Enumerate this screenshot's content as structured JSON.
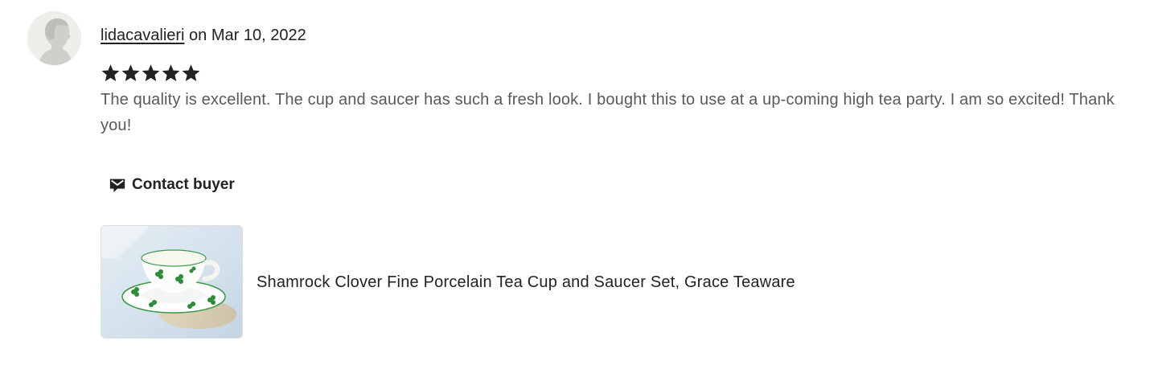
{
  "review": {
    "username": "lidacavalieri",
    "date_prefix": " on ",
    "date": "Mar 10, 2022",
    "rating": 5,
    "rating_max": 5,
    "text": "The quality is excellent. The cup and saucer has such a fresh look. I bought this to use at a up-coming high tea party. I am so excited! Thank you!",
    "contact_label": "Contact buyer",
    "listing_title": "Shamrock Clover Fine Porcelain Tea Cup and Saucer Set, Grace Teaware"
  },
  "icons": {
    "avatar": "default-user-avatar",
    "star": "star-icon",
    "contact": "envelope-icon",
    "thumbnail": "teacup-photo"
  },
  "colors": {
    "text_primary": "#222222",
    "text_secondary": "#595959",
    "avatar_bg": "#eeeeea",
    "star": "#222222"
  }
}
